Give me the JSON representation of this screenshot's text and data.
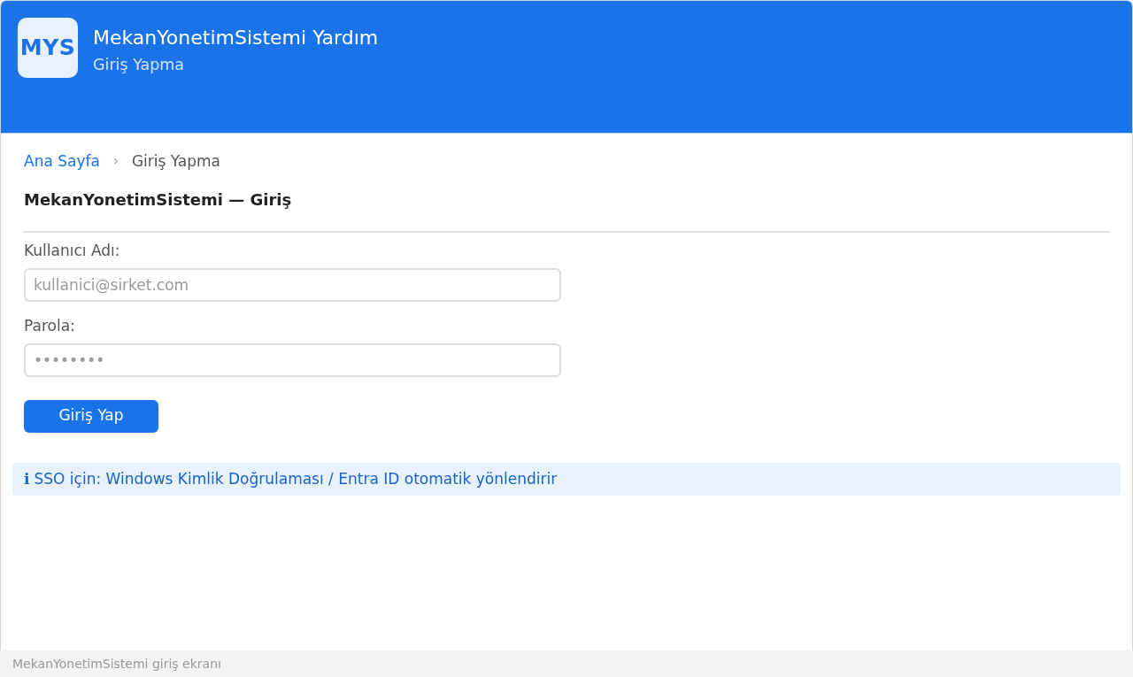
{
  "header": {
    "logo": "MYS",
    "title": "MekanYonetimSistemi Yardım",
    "subtitle": "Giriş Yapma"
  },
  "breadcrumb": {
    "separator": "›",
    "items": [
      {
        "label": "Ana Sayfa",
        "kind": "link"
      },
      {
        "label": "Giriş Yapma",
        "kind": "current"
      }
    ]
  },
  "form": {
    "heading": "MekanYonetimSistemi — Giriş",
    "fields": [
      {
        "label": "Kullanıcı Adı:",
        "placeholder": "kullanici@sirket.com"
      },
      {
        "label": "Parola:",
        "placeholder": "••••••••"
      }
    ],
    "submit": "Giriş Yap"
  },
  "notice": {
    "icon": "ℹ",
    "text": "SSO için: Windows Kimlik Doğrulaması / Entra ID otomatik yönlendirir"
  },
  "status_bar": {
    "text": "MekanYonetimSistemi giriş ekranı"
  }
}
